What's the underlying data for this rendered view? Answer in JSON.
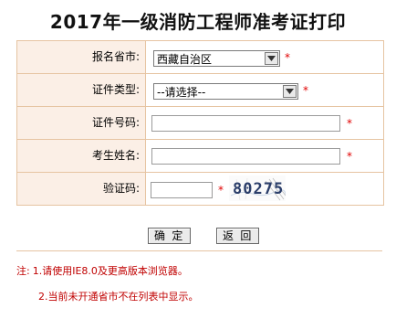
{
  "title": "2017年一级消防工程师准考证打印",
  "form": {
    "province": {
      "label": "报名省市:",
      "selected": "西藏自治区",
      "required": "*"
    },
    "cert_type": {
      "label": "证件类型:",
      "selected": "--请选择--",
      "required": "*"
    },
    "id_number": {
      "label": "证件号码:",
      "value": "",
      "required": "*"
    },
    "name": {
      "label": "考生姓名:",
      "value": "",
      "required": "*"
    },
    "captcha": {
      "label": "验证码:",
      "value": "",
      "required": "*",
      "image_text": "80275"
    }
  },
  "buttons": {
    "confirm": "确 定",
    "back": "返 回"
  },
  "notes": {
    "prefix": "注:",
    "line1": "1.请使用IE8.0及更高版本浏览器。",
    "line2": "2.当前未开通省市不在列表中显示。"
  },
  "colors": {
    "label_bg": "#fbefe6",
    "border": "#e6c4a2",
    "required": "#e00000",
    "note": "#c00000"
  },
  "icons": {
    "dropdown": "chevron-down-icon"
  }
}
